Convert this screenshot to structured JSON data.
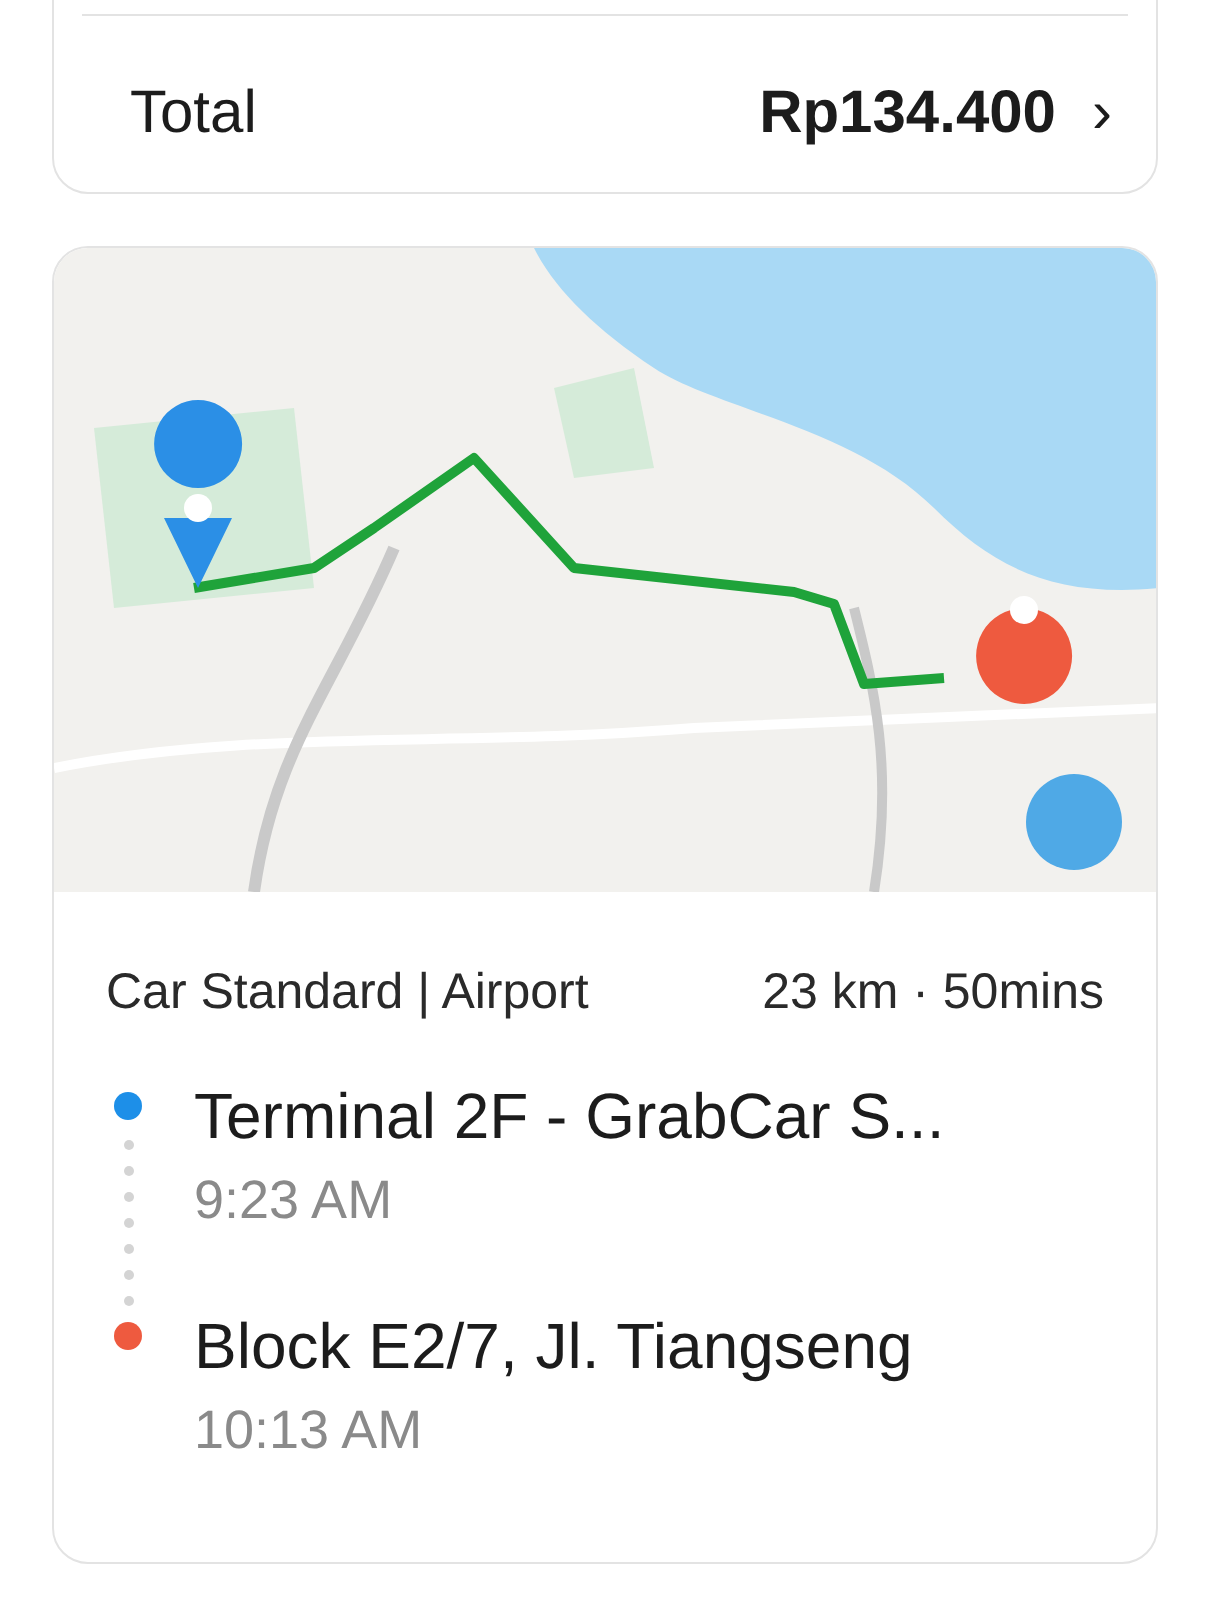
{
  "fare": {
    "total_label": "Total",
    "total_value": "Rp134.400",
    "chevron": "›"
  },
  "trip": {
    "service": "Car Standard | Airport",
    "distance": "23 km · 50mins",
    "stops": [
      {
        "name": "Terminal 2F - GrabCar S...",
        "time": "9:23 AM",
        "color": "#1d8fe8"
      },
      {
        "name": "Block E2/7, Jl. Tiangseng",
        "time": "10:13 AM",
        "color": "#ee5a3f"
      }
    ]
  }
}
